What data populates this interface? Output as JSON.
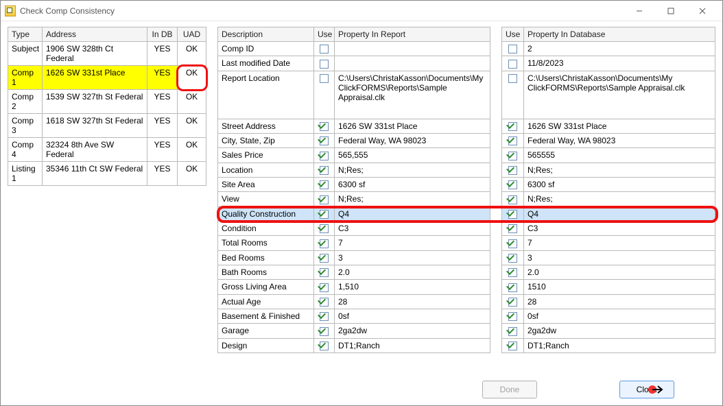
{
  "window": {
    "title": "Check Comp Consistency"
  },
  "left": {
    "headers": [
      "Type",
      "Address",
      "In DB",
      "UAD"
    ],
    "rows": [
      {
        "type": "Subject",
        "address": "1906 SW 328th Ct Federal",
        "indb": "YES",
        "uad": "OK",
        "hl": false
      },
      {
        "type": "Comp 1",
        "address": "1626 SW 331st Place",
        "indb": "YES",
        "uad": "OK",
        "hl": true
      },
      {
        "type": "Comp 2",
        "address": "1539 SW 327th St Federal",
        "indb": "YES",
        "uad": "OK",
        "hl": false
      },
      {
        "type": "Comp 3",
        "address": "1618 SW 327th St Federal",
        "indb": "YES",
        "uad": "OK",
        "hl": false
      },
      {
        "type": "Comp 4",
        "address": "32324 8th Ave SW Federal",
        "indb": "YES",
        "uad": "OK",
        "hl": false
      },
      {
        "type": "Listing 1",
        "address": "35346 11th Ct SW Federal",
        "indb": "YES",
        "uad": "OK",
        "hl": false
      }
    ]
  },
  "mid": {
    "headers": [
      "Description",
      "Use",
      "Property In Report"
    ],
    "rows": [
      {
        "desc": "Comp ID",
        "use": false,
        "val": ""
      },
      {
        "desc": "Last modified Date",
        "use": false,
        "val": ""
      },
      {
        "desc": "Report Location",
        "use": false,
        "val": "C:\\Users\\ChristaKasson\\Documents\\My ClickFORMS\\Reports\\Sample Appraisal.clk",
        "tall": true
      },
      {
        "desc": "Street Address",
        "use": true,
        "val": "1626 SW 331st Place"
      },
      {
        "desc": "City, State, Zip",
        "use": true,
        "val": "Federal Way, WA 98023"
      },
      {
        "desc": "Sales Price",
        "use": true,
        "val": "565,555"
      },
      {
        "desc": "Location",
        "use": true,
        "val": "N;Res;"
      },
      {
        "desc": "Site Area",
        "use": true,
        "val": "6300 sf"
      },
      {
        "desc": "View",
        "use": true,
        "val": "N;Res;"
      },
      {
        "desc": "Quality Construction",
        "use": true,
        "val": "Q4",
        "sel": true
      },
      {
        "desc": "Condition",
        "use": true,
        "val": "C3"
      },
      {
        "desc": "Total Rooms",
        "use": true,
        "val": "7"
      },
      {
        "desc": "Bed Rooms",
        "use": true,
        "val": "3"
      },
      {
        "desc": "Bath Rooms",
        "use": true,
        "val": "2.0"
      },
      {
        "desc": "Gross Living Area",
        "use": true,
        "val": "1,510"
      },
      {
        "desc": "Actual Age",
        "use": true,
        "val": "28"
      },
      {
        "desc": "Basement & Finished",
        "use": true,
        "val": "0sf"
      },
      {
        "desc": "Garage",
        "use": true,
        "val": "2ga2dw"
      },
      {
        "desc": "Design",
        "use": true,
        "val": "DT1;Ranch"
      }
    ]
  },
  "right": {
    "headers": [
      "Use",
      "Property In  Database"
    ],
    "rows": [
      {
        "use": false,
        "val": "2"
      },
      {
        "use": false,
        "val": "11/8/2023"
      },
      {
        "use": false,
        "val": "C:\\Users\\ChristaKasson\\Documents\\My ClickFORMS\\Reports\\Sample Appraisal.clk",
        "tall": true
      },
      {
        "use": true,
        "val": "1626 SW 331st Place"
      },
      {
        "use": true,
        "val": "Federal Way, WA 98023"
      },
      {
        "use": true,
        "val": "565555"
      },
      {
        "use": true,
        "val": "N;Res;"
      },
      {
        "use": true,
        "val": "6300 sf"
      },
      {
        "use": true,
        "val": "N;Res;"
      },
      {
        "use": true,
        "val": "Q4",
        "sel": true
      },
      {
        "use": true,
        "val": "C3"
      },
      {
        "use": true,
        "val": "7"
      },
      {
        "use": true,
        "val": "3"
      },
      {
        "use": true,
        "val": "2.0"
      },
      {
        "use": true,
        "val": "1510"
      },
      {
        "use": true,
        "val": "28"
      },
      {
        "use": true,
        "val": "0sf"
      },
      {
        "use": true,
        "val": "2ga2dw"
      },
      {
        "use": true,
        "val": "DT1;Ranch"
      }
    ]
  },
  "buttons": {
    "done": "Done",
    "close": "Close"
  }
}
